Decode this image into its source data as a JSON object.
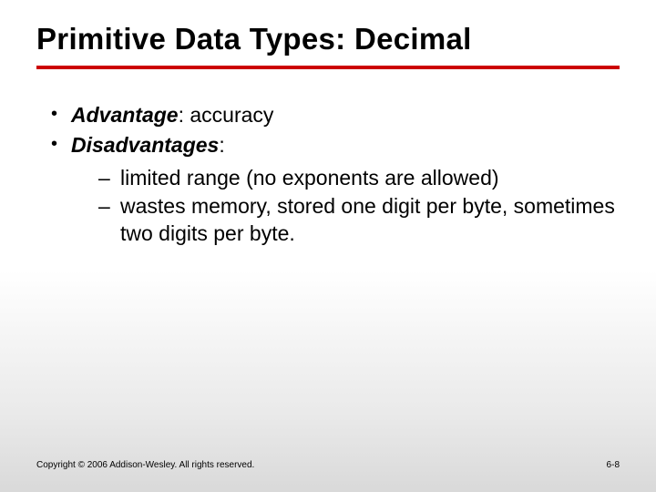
{
  "title": "Primitive Data Types: Decimal",
  "bullets": [
    {
      "emph": "Advantage",
      "rest": ": accuracy"
    },
    {
      "emph": "Disadvantages",
      "rest": ":"
    }
  ],
  "sub_bullets": [
    "limited range (no exponents are allowed)",
    "wastes memory, stored one digit per byte, sometimes two digits per byte."
  ],
  "footer": {
    "copyright": "Copyright © 2006 Addison-Wesley. All rights reserved.",
    "page": "6-8"
  }
}
